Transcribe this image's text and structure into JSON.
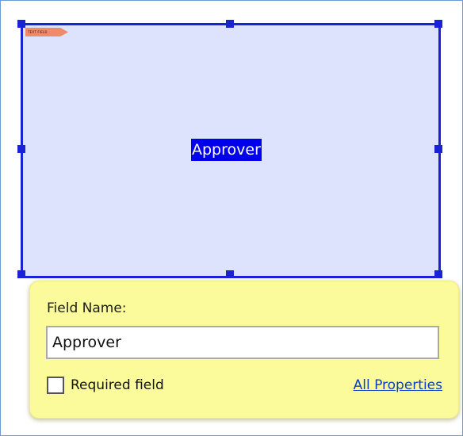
{
  "field": {
    "label": "Approver",
    "tag_text": "TEXT FIELD"
  },
  "popup": {
    "title": "Field Name:",
    "name_value": "Approver",
    "required_label": "Required field",
    "required_checked": false,
    "all_properties_link": "All Properties"
  },
  "colors": {
    "selection_border": "#1a22d6",
    "field_fill": "#dde3fd",
    "label_highlight": "#0000ee",
    "popup_background": "#fbfb9b",
    "tag_fill": "#f08b6a",
    "link": "#0a3ec7"
  },
  "icons": {
    "field_tag": "form-field-tag-icon",
    "resize_handles": "resize-handle-icon"
  }
}
